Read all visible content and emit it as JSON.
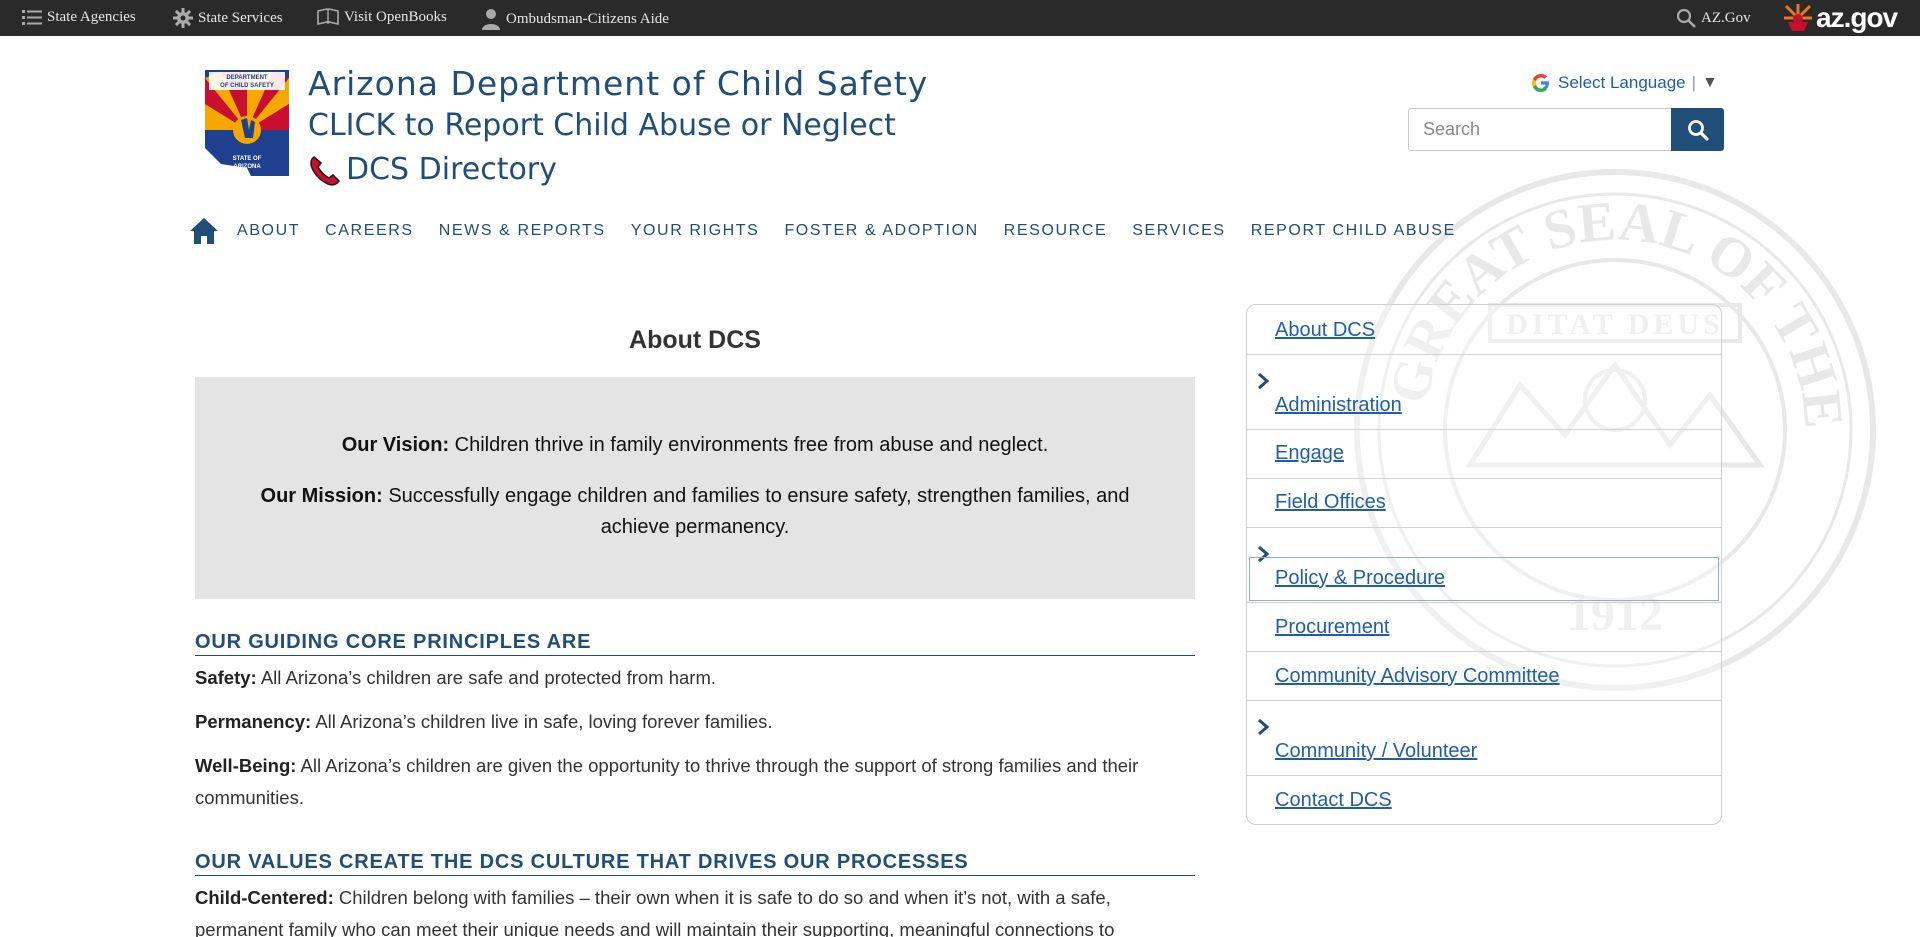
{
  "topbar": {
    "items": [
      {
        "label": "State Agencies",
        "icon": "list-icon"
      },
      {
        "label": "State Services",
        "icon": "gear-icon"
      },
      {
        "label": "Visit OpenBooks",
        "icon": "book-icon"
      },
      {
        "label": "Ombudsman-Citizens Aide",
        "icon": "person-icon"
      }
    ],
    "azgov_label": "AZ.Gov",
    "brand": "az.gov"
  },
  "header": {
    "title": "Arizona Department of Child Safety",
    "report_link": "CLICK to Report Child Abuse or Neglect",
    "directory_link": "DCS Directory",
    "language_label": "Select Language",
    "language_sep": "|",
    "language_caret": "▼",
    "search_placeholder": "Search"
  },
  "nav": {
    "items": [
      "About",
      "Careers",
      "News & Reports",
      "Your Rights",
      "Foster & Adoption",
      "Resource",
      "Services",
      "Report Child Abuse"
    ]
  },
  "main": {
    "title": "About DCS",
    "vision_label": "Our Vision:",
    "vision_text": "Children thrive in family environments free from abuse and neglect.",
    "mission_label": "Our Mission:",
    "mission_text": "Successfully engage children and families to ensure safety, strengthen families, and achieve permanency.",
    "principles_heading": "OUR GUIDING CORE PRINCIPLES ARE",
    "principles": [
      {
        "label": "Safety:",
        "text": "All Arizona’s children are safe and protected from harm."
      },
      {
        "label": "Permanency:",
        "text": "All Arizona’s children live in safe, loving forever families."
      },
      {
        "label": "Well-Being:",
        "text": "All Arizona’s children are given the opportunity to thrive through the support of strong families and their communities."
      }
    ],
    "values_heading": "OUR VALUES CREATE THE DCS CULTURE THAT DRIVES OUR PROCESSES",
    "values": [
      {
        "label": "Child-Centered:",
        "text": "Children belong with families – their own when it is safe to do so and when it’s not, with a safe, permanent family who can meet their unique needs and will maintain their supporting, meaningful connections to"
      }
    ]
  },
  "sidebar": {
    "items": [
      {
        "label": "About DCS",
        "expandable": false
      },
      {
        "label": "Administration",
        "expandable": true
      },
      {
        "label": "Engage",
        "expandable": false
      },
      {
        "label": "Field Offices",
        "expandable": false
      },
      {
        "label": "Policy & Procedure",
        "expandable": true
      },
      {
        "label": "Procurement",
        "expandable": false
      },
      {
        "label": "Community Advisory Committee",
        "expandable": false
      },
      {
        "label": "Community / Volunteer",
        "expandable": true
      },
      {
        "label": "Contact DCS",
        "expandable": false
      }
    ]
  },
  "colors": {
    "primary": "#1f4e79",
    "link": "#1f5fa8",
    "topbar": "#2a2a2a",
    "vision_bg": "#e4e4e4"
  }
}
